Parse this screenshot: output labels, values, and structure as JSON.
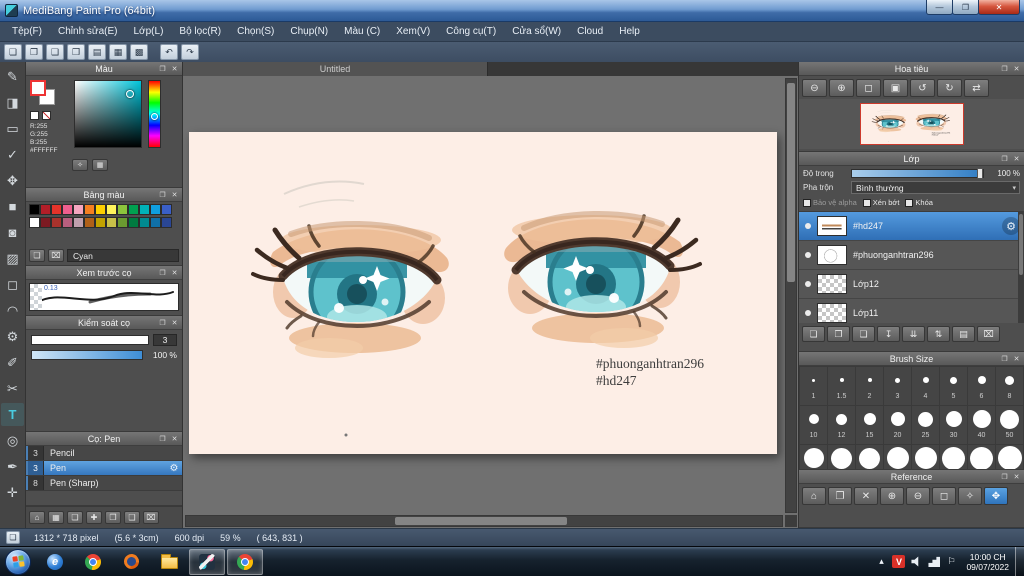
{
  "window": {
    "title": "MediBang Paint Pro (64bit)",
    "controls": [
      {
        "name": "minimize-button",
        "glyph": "—"
      },
      {
        "name": "maximize-button",
        "glyph": "❐"
      },
      {
        "name": "close-button",
        "glyph": "✕",
        "kind": "close"
      }
    ]
  },
  "menu": {
    "items": [
      "Tệp(F)",
      "Chỉnh sửa(E)",
      "Lớp(L)",
      "Bộ lọc(R)",
      "Chọn(S)",
      "Chụp(N)",
      "Màu (C)",
      "Xem(V)",
      "Công cụ(T)",
      "Cửa sổ(W)",
      "Cloud",
      "Help"
    ]
  },
  "toolbar": {
    "file_icons": [
      {
        "name": "new-canvas-icon",
        "glyph": "❏"
      },
      {
        "name": "open-canvas-icon",
        "glyph": "❐"
      },
      {
        "name": "save-icon",
        "glyph": "❑"
      },
      {
        "name": "export-icon",
        "glyph": "❒"
      },
      {
        "name": "materials-icon",
        "glyph": "▤"
      },
      {
        "name": "grid-icon",
        "glyph": "▦"
      },
      {
        "name": "snap-icon",
        "glyph": "▩"
      }
    ],
    "history_icons": [
      {
        "name": "undo-icon",
        "glyph": "↶"
      },
      {
        "name": "redo-icon",
        "glyph": "↷"
      }
    ]
  },
  "tools": {
    "items": [
      {
        "name": "pen-tool-icon",
        "glyph": "✎"
      },
      {
        "name": "eraser-tool-icon",
        "glyph": "◨"
      },
      {
        "name": "marquee-tool-icon",
        "glyph": "▭"
      },
      {
        "name": "magic-wand-tool-icon",
        "glyph": "✓"
      },
      {
        "name": "move-tool-icon",
        "glyph": "✥"
      },
      {
        "name": "shape-tool-icon",
        "glyph": "■"
      },
      {
        "name": "bucket-tool-icon",
        "glyph": "◙"
      },
      {
        "name": "gradient-tool-icon",
        "glyph": "▨"
      },
      {
        "name": "select-tool-icon",
        "glyph": "◻"
      },
      {
        "name": "lasso-tool-icon",
        "glyph": "◠"
      },
      {
        "name": "operation-tool-icon",
        "glyph": "⚙"
      },
      {
        "name": "select-pen-tool-icon",
        "glyph": "✐"
      },
      {
        "name": "select-eraser-tool-icon",
        "glyph": "✂"
      },
      {
        "name": "text-tool-icon",
        "glyph": "T",
        "active": true
      },
      {
        "name": "zoom-tool-icon",
        "glyph": "◎"
      },
      {
        "name": "ink-pen-tool-icon",
        "glyph": "✒"
      },
      {
        "name": "eyedropper-tool-icon",
        "glyph": "✛"
      }
    ]
  },
  "ui": {
    "popout_glyph": "❐",
    "close_glyph": "✕"
  },
  "color_panel": {
    "title": "Màu",
    "rgb_lines": [
      "R:255",
      "G:255",
      "B:255",
      "#FFFFFF"
    ],
    "icons": [
      {
        "name": "eyedropper-mini-icon",
        "glyph": "✧"
      },
      {
        "name": "color-grid-mini-icon",
        "glyph": "▦"
      }
    ]
  },
  "palette_panel": {
    "title": "Bảng màu",
    "selected_name": "Cyan",
    "row1": [
      "#000000",
      "#b21e28",
      "#e5332a",
      "#ee5f8e",
      "#f5a6c0",
      "#f57f20",
      "#fdd000",
      "#fff45c",
      "#8cc43c",
      "#00a050",
      "#00b2b8",
      "#0f9fe0",
      "#3a5fc8"
    ],
    "row2": [
      "#ffffff",
      "#7c1a22",
      "#a8322c",
      "#b85f7e",
      "#c0a0ae",
      "#b06018",
      "#c2a200",
      "#c8c048",
      "#6a9a30",
      "#007a40",
      "#008a90",
      "#1070a8",
      "#2a4694"
    ],
    "icons": [
      {
        "name": "add-palette-color-icon",
        "glyph": "❏"
      },
      {
        "name": "delete-palette-color-icon",
        "glyph": "⌧"
      }
    ]
  },
  "preview_panel": {
    "title": "Xem trước cọ",
    "value": "0.13"
  },
  "control_panel": {
    "title": "Kiểm soát cọ",
    "size_value": "3",
    "opacity_value": "100 %"
  },
  "brush_panel": {
    "title": "Cọ: Pen",
    "items": [
      {
        "size": "3",
        "brush": "Pencil"
      },
      {
        "size": "3",
        "brush": "Pen",
        "selected": true
      },
      {
        "size": "8",
        "brush": "Pen (Sharp)"
      }
    ]
  },
  "left_bottom_icons": [
    {
      "name": "home-icon",
      "glyph": "⌂"
    },
    {
      "name": "workspace-icon",
      "glyph": "▦"
    },
    {
      "name": "new-brush-icon",
      "glyph": "❏"
    },
    {
      "name": "add-brush-icon",
      "glyph": "✚"
    },
    {
      "name": "brush-folder-icon",
      "glyph": "❐"
    },
    {
      "name": "brush-folder-open-icon",
      "glyph": "❑"
    },
    {
      "name": "delete-brush-icon",
      "glyph": "⌧"
    }
  ],
  "canvas": {
    "tab_title": "Untitled",
    "watermark_line1": "#phuonganhtran296",
    "watermark_line2": "#hd247",
    "background": "#fdeee6",
    "iris_color": "#5ec2cc"
  },
  "navigator": {
    "title": "Hoa tiêu",
    "icons": [
      {
        "name": "zoom-out-icon",
        "glyph": "⊖"
      },
      {
        "name": "zoom-in-icon",
        "glyph": "⊕"
      },
      {
        "name": "fit-window-icon",
        "glyph": "◻"
      },
      {
        "name": "actual-size-icon",
        "glyph": "▣"
      },
      {
        "name": "rotate-left-icon",
        "glyph": "↺"
      },
      {
        "name": "rotate-right-icon",
        "glyph": "↻"
      },
      {
        "name": "flip-horizontal-icon",
        "glyph": "⇄"
      }
    ]
  },
  "layers": {
    "title": "Lớp",
    "opacity_label": "Độ trong",
    "opacity_value": "100 %",
    "blend_label": "Pha trộn",
    "blend_value": "Bình thường",
    "checks": [
      {
        "label": "Bảo vệ alpha",
        "dim": true
      },
      {
        "label": "Xén bớt"
      },
      {
        "label": "Khóa"
      }
    ],
    "items": [
      {
        "layer": "#hd247",
        "thumb": "text",
        "selected": true
      },
      {
        "layer": "#phuonganhtran296",
        "thumb": "sketch"
      },
      {
        "layer": "Lớp12",
        "thumb": "checker"
      },
      {
        "layer": "Lớp11",
        "thumb": "checker"
      }
    ],
    "toolbar_icons": [
      {
        "name": "add-layer-icon",
        "glyph": "❏"
      },
      {
        "name": "duplicate-layer-icon",
        "glyph": "❐"
      },
      {
        "name": "layer-folder-icon",
        "glyph": "❑"
      },
      {
        "name": "transfer-layer-icon",
        "glyph": "↧"
      },
      {
        "name": "merge-layer-icon",
        "glyph": "⇊"
      },
      {
        "name": "layer-order-icon",
        "glyph": "⇅"
      },
      {
        "name": "layer-mask-icon",
        "glyph": "▤"
      },
      {
        "name": "delete-layer-icon",
        "glyph": "⌧"
      }
    ]
  },
  "brush_size": {
    "title": "Brush Size",
    "cells": [
      {
        "label": "1",
        "d": "3px"
      },
      {
        "label": "1.5",
        "d": "4px"
      },
      {
        "label": "2",
        "d": "4px"
      },
      {
        "label": "3",
        "d": "5px"
      },
      {
        "label": "4",
        "d": "6px"
      },
      {
        "label": "5",
        "d": "7px"
      },
      {
        "label": "6",
        "d": "8px"
      },
      {
        "label": "8",
        "d": "9px"
      },
      {
        "label": "10",
        "d": "10px"
      },
      {
        "label": "12",
        "d": "11px"
      },
      {
        "label": "15",
        "d": "12px"
      },
      {
        "label": "20",
        "d": "14px"
      },
      {
        "label": "25",
        "d": "15px"
      },
      {
        "label": "30",
        "d": "16px"
      },
      {
        "label": "40",
        "d": "18px"
      },
      {
        "label": "50",
        "d": "19px"
      },
      {
        "label": "",
        "d": "20px"
      },
      {
        "label": "",
        "d": "21px"
      },
      {
        "label": "",
        "d": "21px"
      },
      {
        "label": "",
        "d": "22px"
      },
      {
        "label": "",
        "d": "22px"
      },
      {
        "label": "",
        "d": "23px"
      },
      {
        "label": "",
        "d": "23px"
      },
      {
        "label": "",
        "d": "24px"
      }
    ]
  },
  "reference": {
    "title": "Reference",
    "icons": [
      {
        "name": "ref-home-icon",
        "glyph": "⌂"
      },
      {
        "name": "ref-open-icon",
        "glyph": "❐"
      },
      {
        "name": "ref-clear-icon",
        "glyph": "✕"
      },
      {
        "name": "ref-zoom-in-icon",
        "glyph": "⊕"
      },
      {
        "name": "ref-zoom-out-icon",
        "glyph": "⊖"
      },
      {
        "name": "ref-fit-icon",
        "glyph": "◻"
      },
      {
        "name": "ref-eyedropper-icon",
        "glyph": "✧"
      },
      {
        "name": "ref-hand-icon",
        "glyph": "✥",
        "active": true
      }
    ]
  },
  "statusbar": {
    "segments": [
      "1312 * 718 pixel",
      "(5.6 * 3cm)",
      "600 dpi",
      "59 %",
      "( 643, 831 )"
    ]
  },
  "taskbar": {
    "apps": [
      {
        "name": "taskbar-ie-icon",
        "icon": "ie"
      },
      {
        "name": "taskbar-chrome-icon",
        "icon": "chrome"
      },
      {
        "name": "taskbar-firefox-icon",
        "icon": "firefox"
      },
      {
        "name": "taskbar-explorer-icon",
        "icon": "folder"
      },
      {
        "name": "taskbar-medibang-icon",
        "icon": "medibang",
        "active": true
      },
      {
        "name": "taskbar-chrome-window-icon",
        "icon": "chrome",
        "active": true
      }
    ],
    "tray_icons": [
      {
        "name": "hidden-icons-icon",
        "glyph": "▴"
      },
      {
        "name": "unikey-icon",
        "glyph": "V",
        "icon": "unikey"
      },
      {
        "name": "volume-icon",
        "icon": "speaker"
      },
      {
        "name": "network-icon",
        "icon": "network"
      },
      {
        "name": "action-center-icon",
        "glyph": "⚐"
      }
    ],
    "clock_time": "10:00 CH",
    "clock_date": "09/07/2022"
  }
}
